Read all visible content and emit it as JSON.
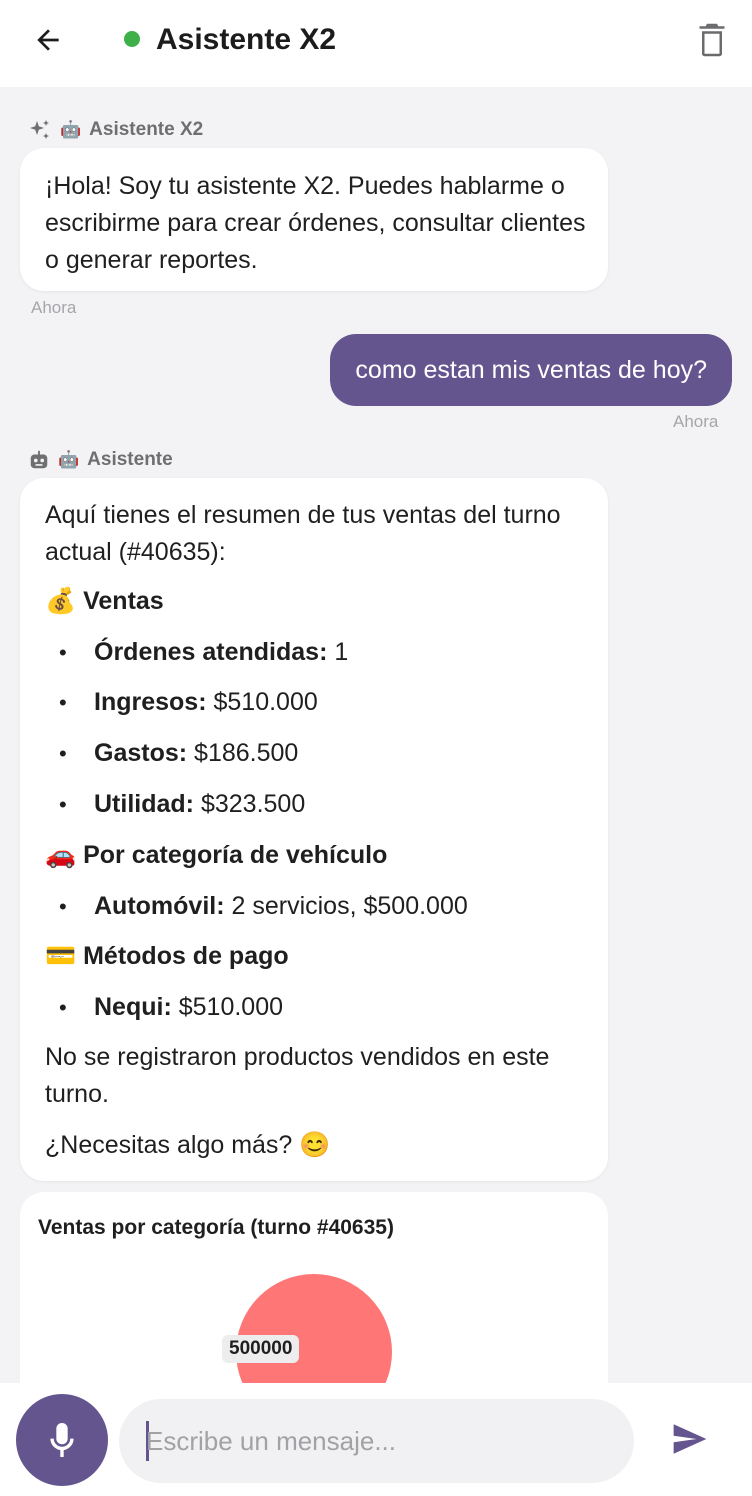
{
  "header": {
    "title": "Asistente X2",
    "status_color": "#3db04a"
  },
  "messages": {
    "bot1": {
      "sender": "Asistente X2",
      "sender_emoji": "🤖",
      "text": "¡Hola! Soy tu asistente X2. Puedes hablarme o escribirme para crear órdenes, consultar clientes o generar reportes.",
      "time": "Ahora"
    },
    "user1": {
      "text": "como estan mis ventas de hoy?",
      "time": "Ahora"
    },
    "bot2": {
      "sender": "Asistente",
      "sender_emoji": "🤖",
      "intro": "Aquí tienes el resumen de tus ventas del turno actual (#40635):",
      "sections": {
        "ventas": {
          "emoji": "💰",
          "heading": "Ventas",
          "items": [
            {
              "label": "Órdenes atendidas:",
              "value": "1"
            },
            {
              "label": "Ingresos:",
              "value": "$510.000"
            },
            {
              "label": "Gastos:",
              "value": "$186.500"
            },
            {
              "label": "Utilidad:",
              "value": "$323.500"
            }
          ]
        },
        "categoria": {
          "emoji": "🚗",
          "heading": "Por categoría de vehículo",
          "items": [
            {
              "label": "Automóvil:",
              "value": "2 servicios, $500.000"
            }
          ]
        },
        "pago": {
          "emoji": "💳",
          "heading": "Métodos de pago",
          "items": [
            {
              "label": "Nequi:",
              "value": "$510.000"
            }
          ]
        }
      },
      "closing": "No se registraron productos vendidos en este turno.",
      "question": "¿Necesitas algo más?",
      "question_emoji": "😊"
    }
  },
  "chart_data": {
    "type": "pie",
    "title": "Ventas por categoría (turno #40635)",
    "slices": [
      {
        "value": 500000,
        "label": "500000",
        "color": "#ff7676"
      }
    ]
  },
  "input": {
    "placeholder": "Escribe un mensaje...",
    "value": ""
  },
  "theme": {
    "accent": "#65558f",
    "background": "#f3f3f5"
  }
}
